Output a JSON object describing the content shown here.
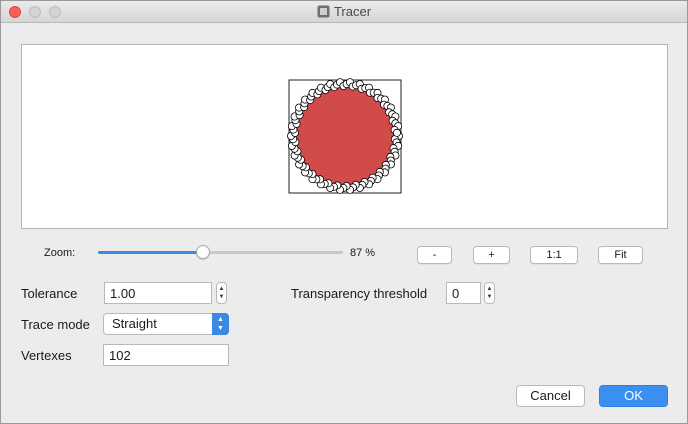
{
  "window": {
    "title": "Tracer",
    "controls": [
      "close",
      "minimize",
      "maximize"
    ]
  },
  "preview": {
    "shape_color": "#d24b4b",
    "vertex_color": "#ffffff"
  },
  "zoom": {
    "label": "Zoom:",
    "value_text": "87 %",
    "slider_fraction": 0.43,
    "buttons": {
      "zoom_out": "-",
      "zoom_in": "+",
      "actual_size": "1:1",
      "fit": "Fit"
    }
  },
  "form": {
    "tolerance": {
      "label": "Tolerance",
      "value": "1.00"
    },
    "transparency": {
      "label": "Transparency threshold",
      "value": "0"
    },
    "trace_mode": {
      "label": "Trace mode",
      "value": "Straight"
    },
    "vertexes": {
      "label": "Vertexes",
      "value": "102"
    }
  },
  "buttons": {
    "cancel": "Cancel",
    "ok": "OK"
  },
  "colors": {
    "accent": "#3b89e3",
    "close": "#fc5f57"
  }
}
